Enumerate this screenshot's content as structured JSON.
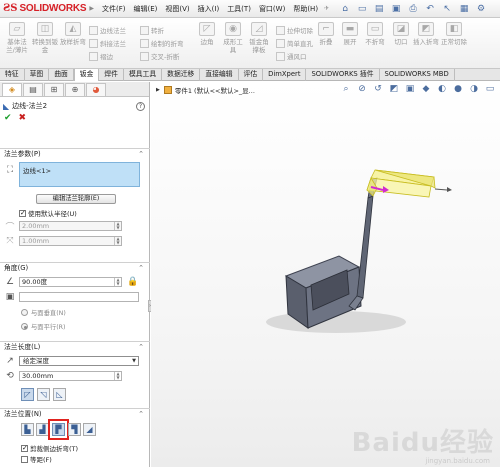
{
  "app": {
    "brand": "SOLIDWORKS",
    "menu": [
      "文件(F)",
      "编辑(E)",
      "视图(V)",
      "插入(I)",
      "工具(T)",
      "窗口(W)",
      "帮助(H)"
    ]
  },
  "ribbon": {
    "big_buttons": [
      {
        "label": "基体法兰/薄片",
        "icon": "base-flange-icon"
      },
      {
        "label": "转换到钣金",
        "icon": "convert-sheet-metal-icon"
      },
      {
        "label": "放样折弯",
        "icon": "lofted-bend-icon"
      },
      {
        "label": "边角",
        "icon": "corners-icon"
      },
      {
        "label": "成形工具",
        "icon": "forming-tool-icon"
      },
      {
        "label": "钣金角撑板",
        "icon": "sheet-metal-gusset-icon"
      },
      {
        "label": "折叠",
        "icon": "fold-icon"
      },
      {
        "label": "展开",
        "icon": "unfold-icon"
      },
      {
        "label": "不折弯",
        "icon": "no-bends-icon"
      },
      {
        "label": "切口",
        "icon": "rip-icon"
      },
      {
        "label": "插入折弯",
        "icon": "insert-bends-icon"
      },
      {
        "label": "正常切除",
        "icon": "normal-cut-icon"
      }
    ],
    "small_buttons": [
      {
        "label": "边线法兰",
        "icon": "edge-flange-icon"
      },
      {
        "label": "斜接法兰",
        "icon": "miter-flange-icon"
      },
      {
        "label": "褶边",
        "icon": "hem-icon"
      },
      {
        "label": "转折",
        "icon": "jog-icon"
      },
      {
        "label": "绘制的折弯",
        "icon": "sketched-bend-icon"
      },
      {
        "label": "交叉-折断",
        "icon": "cross-break-icon"
      },
      {
        "label": "拉伸切除",
        "icon": "extruded-cut-icon"
      },
      {
        "label": "简单直孔",
        "icon": "simple-hole-icon"
      },
      {
        "label": "通风口",
        "icon": "vent-icon"
      }
    ]
  },
  "tabs": [
    "特征",
    "草图",
    "曲面",
    "钣金",
    "焊件",
    "模具工具",
    "数据迁移",
    "直接编辑",
    "评估",
    "DimXpert",
    "SOLIDWORKS 插件",
    "SOLIDWORKS MBD"
  ],
  "active_tab": "钣金",
  "property_manager": {
    "title": "边线-法兰2",
    "help": "?",
    "flange_params": {
      "header": "法兰参数(P)",
      "selection": "边线<1>",
      "edit_profile_button": "编辑法兰轮廓(E)",
      "use_default_radius": "使用默认半径(U)",
      "radius": "2.00mm",
      "gap": "1.00mm"
    },
    "angle": {
      "header": "角度(G)",
      "value": "90.00度",
      "face_value": "",
      "opt_perpendicular": "与面垂直(N)",
      "opt_parallel": "与面平行(R)"
    },
    "length": {
      "header": "法兰长度(L)",
      "end_condition": "给定深度",
      "value": "30.00mm"
    },
    "position": {
      "header": "法兰位置(N)",
      "trim_side_bends": "剪裁侧边折弯(T)",
      "offset": "等距(F)"
    }
  },
  "graphics": {
    "tree_label": "零件1 (默认<<默认>_显..."
  },
  "watermark": {
    "text": "Baidu经验",
    "url": "jingyan.baidu.com"
  },
  "colors": {
    "accent_red": "#d62027",
    "selection_blue": "#bfe0f7",
    "highlight_red": "#e0231f",
    "preview_yellow": "#f5f08a"
  }
}
